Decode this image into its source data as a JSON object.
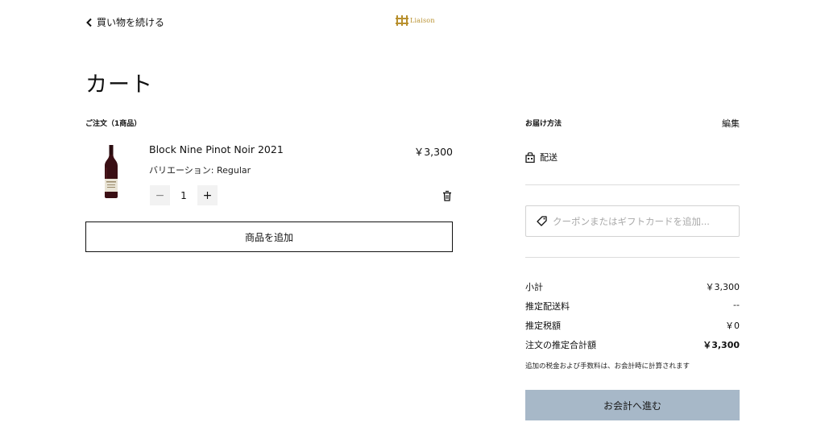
{
  "header": {
    "back_label": "買い物を続ける",
    "logo_text": "Liaison",
    "logo_color": "#b8902e"
  },
  "page": {
    "title": "カート"
  },
  "order": {
    "heading": "ご注文（1商品）",
    "items": [
      {
        "name": "Block Nine Pinot Noir 2021",
        "price": "￥3,300",
        "variant": "バリエーション: Regular",
        "quantity": "1",
        "minus_label": "−",
        "plus_label": "+"
      }
    ],
    "add_product_label": "商品を追加"
  },
  "delivery": {
    "heading": "お届け方法",
    "edit_label": "編集",
    "method": "配送"
  },
  "coupon": {
    "placeholder": "クーポンまたはギフトカードを追加..."
  },
  "summary": {
    "rows": [
      {
        "label": "小計",
        "value": "￥3,300"
      },
      {
        "label": "推定配送料",
        "value": "--"
      },
      {
        "label": "推定税額",
        "value": "￥0"
      },
      {
        "label": "注文の推定合計額",
        "value": "￥3,300"
      }
    ],
    "note": "追加の税金および手数料は、お会計時に計算されます"
  },
  "checkout": {
    "label": "お会計へ進む",
    "color": "#a7b8c8"
  },
  "icons": {
    "back": "chevron-left-icon",
    "logo": "castle-logo-icon",
    "shipping": "store-bag-icon",
    "trash": "trash-icon",
    "coupon": "tag-icon"
  }
}
